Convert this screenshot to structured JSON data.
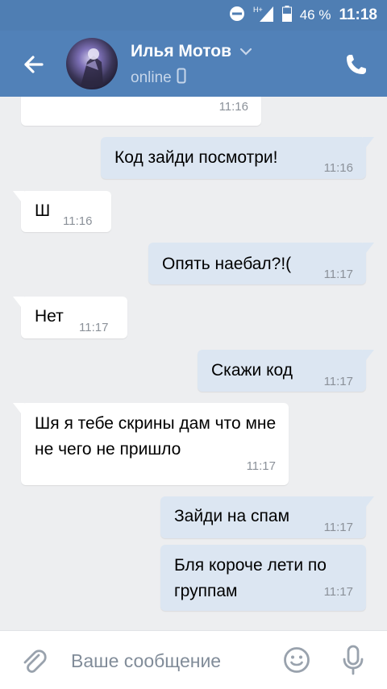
{
  "status_bar": {
    "battery": "46 %",
    "time": "11:18",
    "network": "H+"
  },
  "header": {
    "contact_name": "Илья Мотов",
    "presence": "online"
  },
  "messages": [
    {
      "dir": "in",
      "text": "",
      "time": "11:16"
    },
    {
      "dir": "out",
      "text": "Код зайди посмотри!",
      "time": "11:16"
    },
    {
      "dir": "in",
      "text": "Ш",
      "time": "11:16"
    },
    {
      "dir": "out",
      "text": "Опять наебал?!(",
      "time": "11:17"
    },
    {
      "dir": "in",
      "text": "Нет",
      "time": "11:17"
    },
    {
      "dir": "out",
      "text": "Скажи код",
      "time": "11:17"
    },
    {
      "dir": "in",
      "text": "Шя я тебе скрины дам что мне не чего не пришло",
      "time": "11:17"
    },
    {
      "dir": "out",
      "text": "Зайди на спам",
      "time": "11:17"
    },
    {
      "dir": "out",
      "text": "Бля короче лети по группам",
      "time": "11:17"
    }
  ],
  "composer": {
    "placeholder": "Ваше сообщение"
  },
  "colors": {
    "header_bg": "#5181b8",
    "statusbar_bg": "#4f7eb3",
    "chat_bg": "#edeef0",
    "bubble_in": "#ffffff",
    "bubble_out": "#dce6f2"
  },
  "icons": [
    "back-arrow-icon",
    "chevron-down-icon",
    "mobile-icon",
    "phone-icon",
    "paperclip-icon",
    "smile-icon",
    "microphone-icon",
    "dnd-icon",
    "signal-icon",
    "battery-icon"
  ]
}
